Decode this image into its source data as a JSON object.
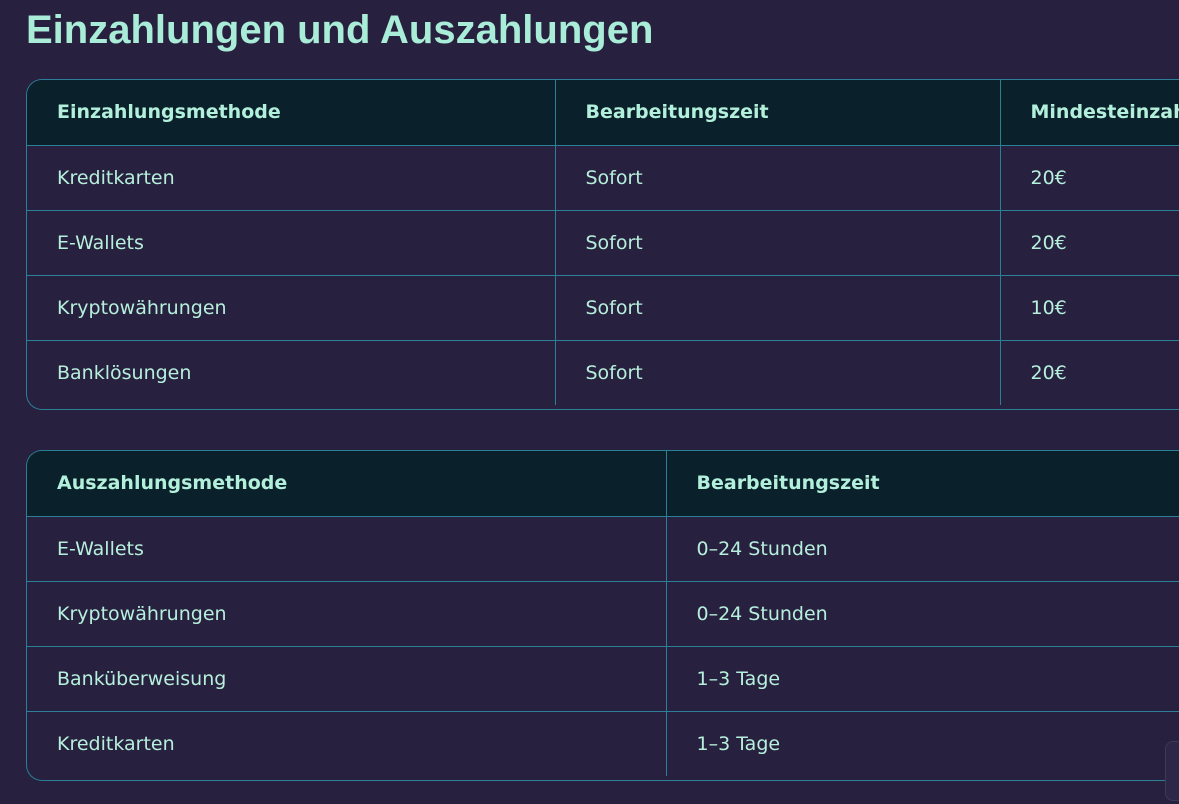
{
  "page": {
    "title": "Einzahlungen und Auszahlungen"
  },
  "deposit_table": {
    "headers": [
      "Einzahlungsmethode",
      "Bearbeitungszeit",
      "Mindesteinzahl"
    ],
    "rows": [
      [
        "Kreditkarten",
        "Sofort",
        "20€"
      ],
      [
        "E-Wallets",
        "Sofort",
        "20€"
      ],
      [
        "Kryptowährungen",
        "Sofort",
        "10€"
      ],
      [
        "Banklösungen",
        "Sofort",
        "20€"
      ]
    ]
  },
  "withdraw_table": {
    "headers": [
      "Auszahlungsmethode",
      "Bearbeitungszeit"
    ],
    "rows": [
      [
        "E-Wallets",
        "0–24 Stunden"
      ],
      [
        "Kryptowährungen",
        "0–24 Stunden"
      ],
      [
        "Banküberweisung",
        "1–3 Tage"
      ],
      [
        "Kreditkarten",
        "1–3 Tage"
      ]
    ]
  },
  "colors": {
    "background": "#27213f",
    "header_background": "#0a212c",
    "border": "#2b7f97",
    "text": "#b6f0dc",
    "title": "#a9ecd7"
  }
}
